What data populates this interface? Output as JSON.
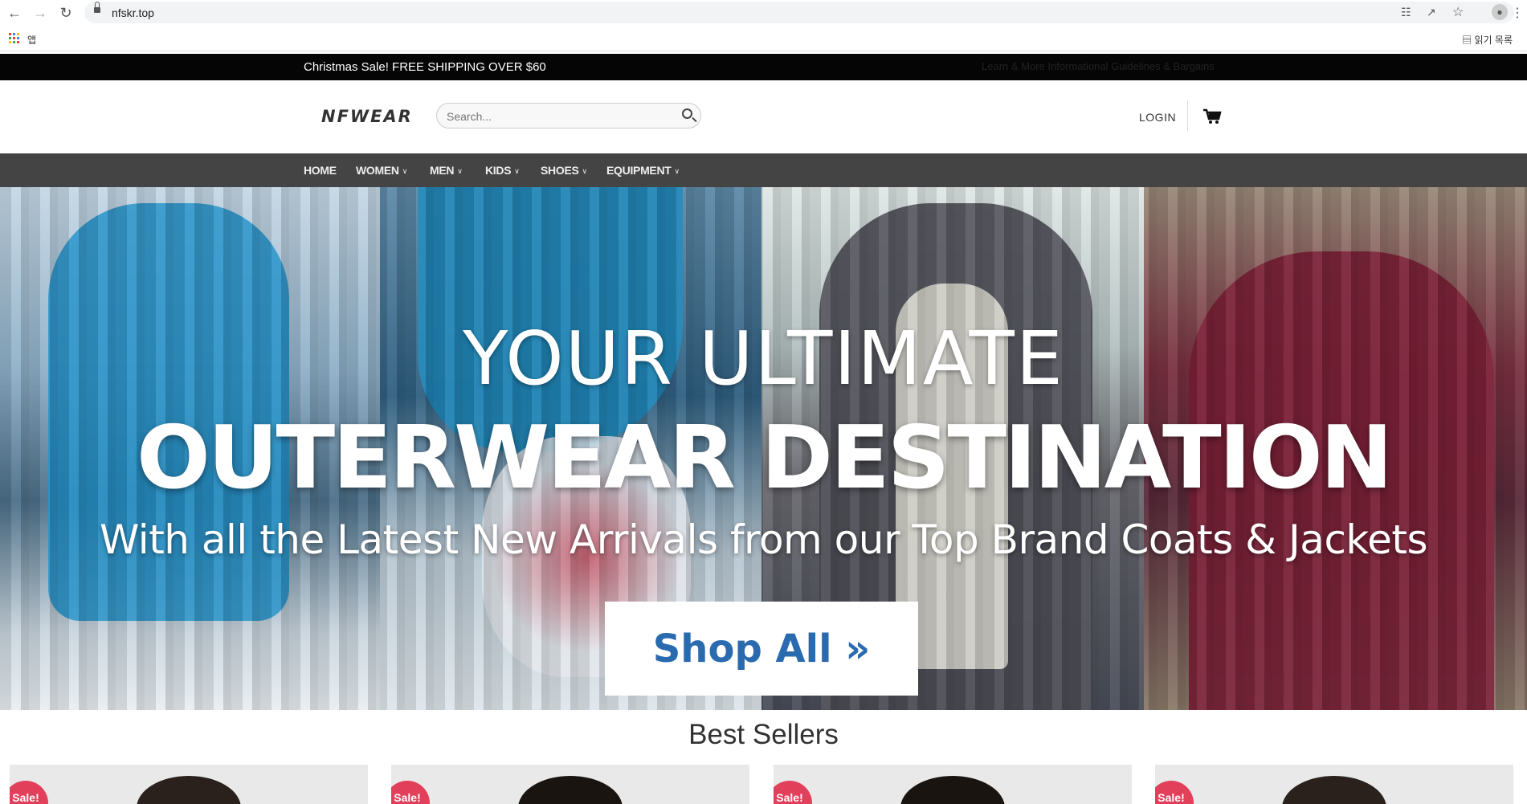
{
  "browser": {
    "url": "nfskr.top",
    "bookmarks_label": "앱",
    "reading_list_label": "읽기 목록"
  },
  "promo": {
    "text": "Christmas Sale! FREE SHIPPING OVER $60",
    "secondary_text": "Learn & More Informational Guidelines & Bargains"
  },
  "header": {
    "logo": "NFWEAR",
    "search_placeholder": "Search...",
    "login_label": "LOGIN"
  },
  "nav": {
    "items": [
      {
        "label": "HOME",
        "dropdown": false
      },
      {
        "label": "WOMEN",
        "dropdown": true
      },
      {
        "label": "MEN",
        "dropdown": true
      },
      {
        "label": "KIDS",
        "dropdown": true
      },
      {
        "label": "SHOES",
        "dropdown": true
      },
      {
        "label": "EQUIPMENT",
        "dropdown": true
      }
    ]
  },
  "hero": {
    "line1": "YOUR ULTIMATE",
    "line2": "OUTERWEAR DESTINATION",
    "line3": "With all the Latest New Arrivals from our Top Brand Coats & Jackets",
    "cta_label": "Shop All »"
  },
  "best_sellers": {
    "title": "Best Sellers",
    "cards": [
      {
        "badge": "Sale!"
      },
      {
        "badge": "Sale!"
      },
      {
        "badge": "Sale!"
      },
      {
        "badge": "Sale!"
      }
    ]
  },
  "colors": {
    "promo_bg": "#050505",
    "nav_bg": "#444444",
    "cta_text": "#2a6bb0",
    "sale_badge": "#e23f5b"
  }
}
